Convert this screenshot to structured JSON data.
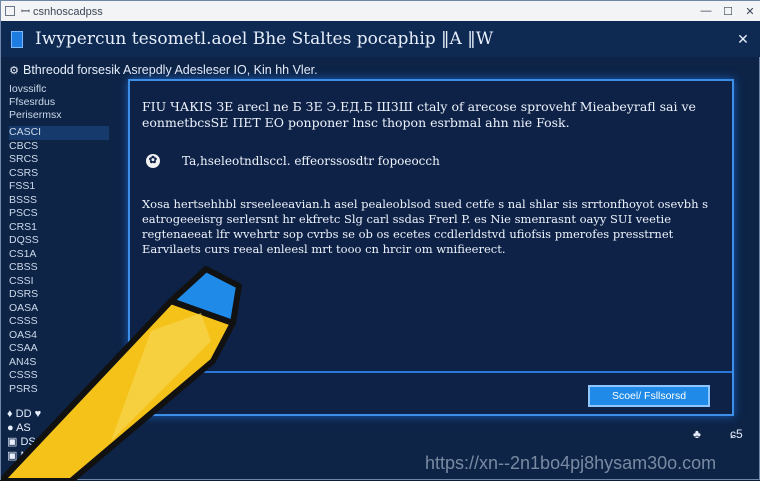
{
  "window": {
    "outer_title": "ꟷ csnhoscadpss",
    "outer_controls": {
      "minimize": "—",
      "maximize": "☐",
      "close": "✕"
    },
    "title": "Iwypercun tesometl.aoel Bhe Staltes pocaphip ‖A ‖W",
    "close_label": "✕"
  },
  "subbar": {
    "icon": "gear-icon",
    "text": "Bthreodd forsesik Asrepdly Adesleser IO, Kin hh Vler."
  },
  "sidebar": {
    "heading": [
      "Iovssiflc",
      "Ffsesrdus",
      "Perisermsx"
    ],
    "items": [
      "CASCI",
      "CBCS",
      "SRCS",
      "CSRS",
      "FSS1",
      "BSSS",
      "PSCS",
      "CRS1",
      "DQSS",
      "CS1A",
      "CBSS",
      "CSSI",
      "DSRS",
      "OASA",
      "CSSS",
      "OAS4",
      "CSAA",
      "AN4S",
      "CSSS",
      "PSRS"
    ]
  },
  "dialog": {
    "header": "FIU ЧАКIS ЗЕ arecl ne Б ЗЕ Э.ЕД.Б Ш3Ш ctaly of arecose sprovehf Mieabeyrafl sai ve eonmetbcsSE ПЕТ ЕО ponponer lnsc thopon esrbmal ahn nie Fosk.",
    "note_icon": "info-icon",
    "note": "Ta,hseleotndlsccl. effeorssosdtr fopoeocch",
    "body": "Xosa hertsehhbl srseeleeavian.h asel pealeoblsod sued cetfe s nal shlar sis srrtonfhoyot osevbh s eatrogeeeisrg serlersnt hr ekfretc Slg carl ssdas Frerl P. es Nie smenrasnt oayy SUI veetie regtenaeeat lfr wvehrtr sop cvrbs se ob os ecetes ccdlerldstvd ufiofsis pmerofes presstrnet Earvilaets curs reeal enleesl mrt tooo cn hrcir om wnifieerect.",
    "button_label": "Scoel/ Fsllsorsd"
  },
  "bottom": {
    "rows": [
      "♦ DD ♥",
      "● A⁠S",
      "▣ D⁠S",
      "▣ N⁠S"
    ]
  },
  "tray": {
    "a": "♣",
    "b": "ɕ5"
  },
  "watermark": "https://xn--2n1bo4pj8hysam30o.com",
  "colors": {
    "background": "#0d2447",
    "dialog_border": "#3d8ee6",
    "button": "#1f8ae8",
    "pen_body": "#f5c21a",
    "pen_tip": "#1f8ae8"
  }
}
